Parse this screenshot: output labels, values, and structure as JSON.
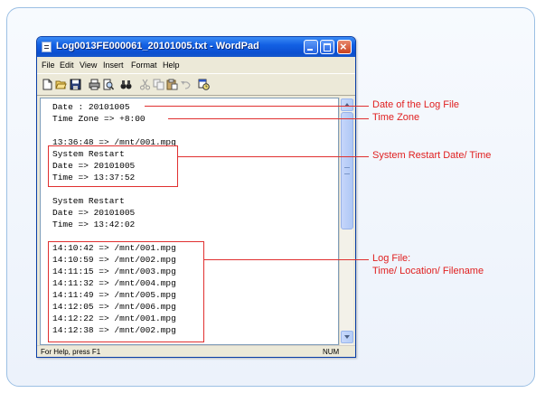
{
  "window": {
    "title": "Log0013FE000061_20101005.txt - WordPad"
  },
  "menu": [
    "File",
    "Edit",
    "View",
    "Insert",
    "Format",
    "Help"
  ],
  "document": {
    "lines": [
      "Date : 20101005",
      "Time Zone => +8:00",
      "",
      "13:36:48 => /mnt/001.mpg",
      "System Restart",
      "Date => 20101005",
      "Time => 13:37:52",
      "",
      "System Restart",
      "Date => 20101005",
      "Time => 13:42:02",
      "",
      "14:10:42 => /mnt/001.mpg",
      "14:10:59 => /mnt/002.mpg",
      "14:11:15 => /mnt/003.mpg",
      "14:11:32 => /mnt/004.mpg",
      "14:11:49 => /mnt/005.mpg",
      "14:12:05 => /mnt/006.mpg",
      "14:12:22 => /mnt/001.mpg",
      "14:12:38 => /mnt/002.mpg"
    ]
  },
  "status": {
    "help": "For Help, press F1",
    "num": "NUM"
  },
  "callouts": {
    "date": "Date of the Log File",
    "timezone": "Time Zone",
    "restart": "System Restart Date/ Time",
    "logfile_line1": "Log File:",
    "logfile_line2": "Time/ Location/ Filename"
  },
  "colors": {
    "accent": "#e03030",
    "frame_border": "#9cc0e4",
    "titlebar": "#0b4fd1"
  }
}
